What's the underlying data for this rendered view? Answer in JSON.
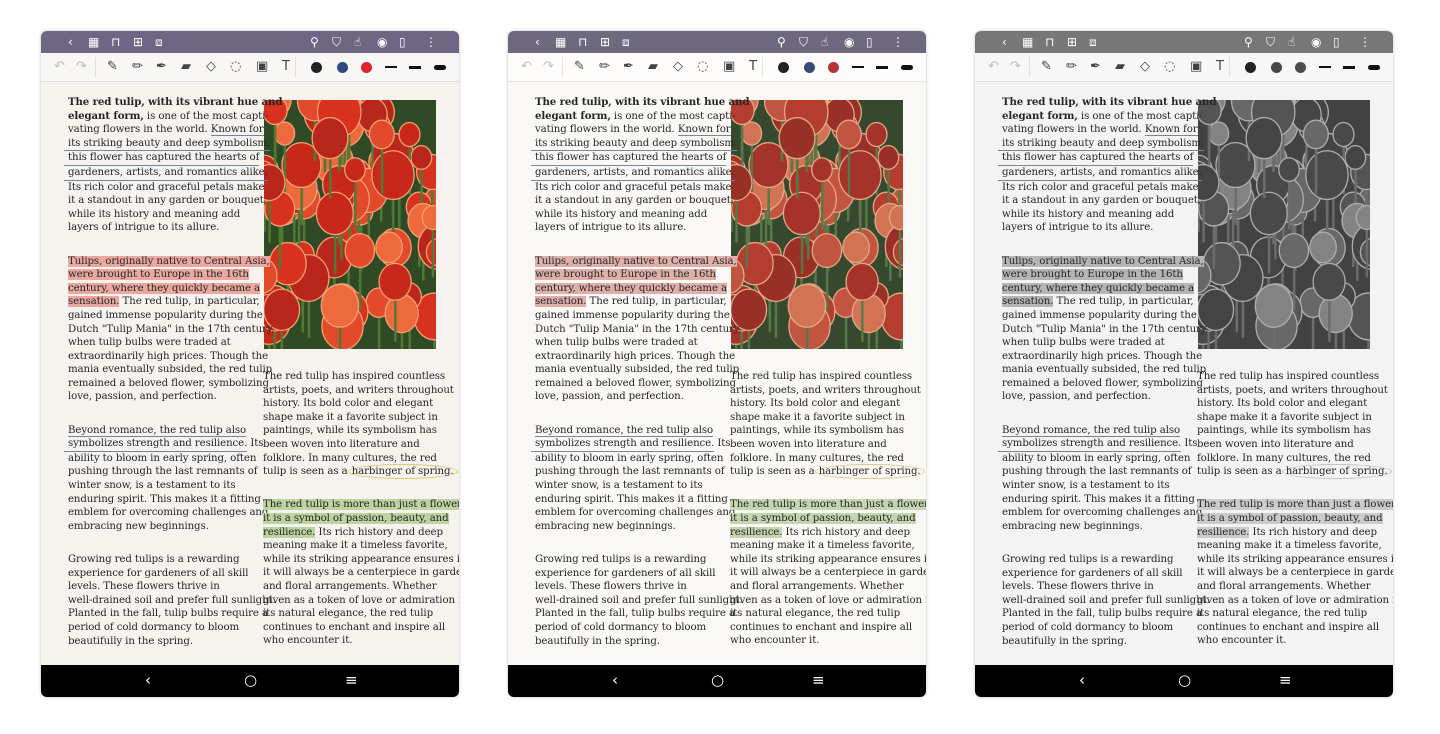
{
  "colors": {
    "topbar_color": "#6e6684",
    "topbar_gray": "#777777",
    "highlight_red": "#eaa8a0",
    "highlight_green": "#bdd3a0",
    "underline": "#6f86a3",
    "circle": "#e4c46a",
    "pen_black": "#222222",
    "pen_blue": "#2d4a86",
    "pen_red": "#e0242e"
  },
  "topbar": {
    "icons": [
      "back-icon",
      "grid-icon",
      "bookmark-icon",
      "add-page-icon",
      "crop-icon",
      "search-icon",
      "shirt-icon",
      "touch-icon",
      "eye-icon",
      "page-icon",
      "more-icon"
    ],
    "glyphs": {
      "back": "‹",
      "grid": "▦",
      "bookmark": "⊓",
      "add": "⊞",
      "crop": "⧈",
      "search": "⚲",
      "shirt": "⛉",
      "touch": "☝",
      "eye": "◉",
      "page": "▯",
      "more": "⋮"
    }
  },
  "toolbar": {
    "glyphs": {
      "undo": "↶",
      "redo": "↷",
      "pen": "✎",
      "pencil": "✏",
      "marker": "✒",
      "highlighter": "▰",
      "eraser": "◇",
      "lasso": "◌",
      "image": "▣",
      "text": "T"
    }
  },
  "navbar": {
    "glyphs": {
      "back": "‹",
      "home": "○",
      "menu": "≡"
    }
  },
  "tablets": [
    {
      "variant": "color"
    },
    {
      "variant": "e-ink color"
    },
    {
      "variant": "grayscale"
    }
  ],
  "article": {
    "col1": [
      [
        [
          [
            "The red tulip, with its vibrant hue and",
            "b"
          ]
        ],
        [
          [
            "elegant form,",
            "b"
          ],
          [
            " is one of the most capti-",
            ""
          ]
        ],
        [
          [
            "vating flowers in the world. ",
            ""
          ],
          [
            "Known for",
            "u"
          ]
        ],
        [
          [
            "its striking beauty and deep symbolism,",
            "ul"
          ]
        ],
        [
          [
            "this flower has captured the hearts of",
            "ul"
          ]
        ],
        [
          [
            "gardeners, artists, and romantics alike.",
            "ul"
          ]
        ],
        [
          [
            "Its rich color and graceful petals make",
            ""
          ]
        ],
        [
          [
            "it a standout in any garden or bouquet,",
            ""
          ]
        ],
        [
          [
            "while its history and meaning add",
            ""
          ]
        ],
        [
          [
            "layers of intrigue to its allure.",
            ""
          ]
        ]
      ],
      [
        [
          [
            "Tulips, originally native to Central Asia,",
            "hr"
          ]
        ],
        [
          [
            "were brought to Europe in the 16th",
            "hr"
          ]
        ],
        [
          [
            "century, where they quickly became a",
            "hr"
          ]
        ],
        [
          [
            "sensation.",
            "hr"
          ],
          [
            " The red tulip, in particular,",
            ""
          ]
        ],
        [
          [
            "gained immense popularity during the",
            ""
          ]
        ],
        [
          [
            "Dutch \"Tulip Mania\" in the 17th century,",
            ""
          ]
        ],
        [
          [
            "when tulip bulbs were traded at",
            ""
          ]
        ],
        [
          [
            "extraordinarily high prices. Though the",
            ""
          ]
        ],
        [
          [
            "mania eventually subsided, the red tulip",
            ""
          ]
        ],
        [
          [
            "remained a beloved flower, symbolizing",
            ""
          ]
        ],
        [
          [
            "love, passion, and perfection.",
            ""
          ]
        ]
      ],
      [
        [
          [
            "Beyond romance, the red tulip also",
            "u"
          ]
        ],
        [
          [
            "symbolizes strength and resilience.",
            "ul"
          ],
          [
            " Its",
            ""
          ]
        ],
        [
          [
            "ability to bloom in early spring, often",
            ""
          ]
        ],
        [
          [
            "pushing through the last remnants of",
            ""
          ]
        ],
        [
          [
            "winter snow, is a testament to its",
            ""
          ]
        ],
        [
          [
            "enduring spirit. This makes it a fitting",
            ""
          ]
        ],
        [
          [
            "emblem for overcoming challenges and",
            ""
          ]
        ],
        [
          [
            "embracing new beginnings.",
            ""
          ]
        ]
      ],
      [
        [
          [
            "Growing red tulips is a rewarding",
            ""
          ]
        ],
        [
          [
            "experience for gardeners of all skill",
            ""
          ]
        ],
        [
          [
            "levels. These flowers thrive in",
            ""
          ]
        ],
        [
          [
            "well-drained soil and prefer full sunlight.",
            ""
          ]
        ],
        [
          [
            "Planted in the fall, tulip bulbs require a",
            ""
          ]
        ],
        [
          [
            "period of cold dormancy to bloom",
            ""
          ]
        ],
        [
          [
            "beautifully in the spring.",
            ""
          ]
        ]
      ]
    ],
    "col2": [
      [
        [
          [
            "The red tulip has inspired countless",
            ""
          ]
        ],
        [
          [
            "artists, poets, and writers throughout",
            ""
          ]
        ],
        [
          [
            "history. Its bold color and elegant",
            ""
          ]
        ],
        [
          [
            "shape make it a favorite subject in",
            ""
          ]
        ],
        [
          [
            "paintings, while its symbolism has",
            ""
          ]
        ],
        [
          [
            "been woven into literature and",
            ""
          ]
        ],
        [
          [
            "folklore. In many cultures, the red",
            ""
          ]
        ],
        [
          [
            "tulip is seen as a ",
            ""
          ],
          [
            "harbinger of spring.",
            "c"
          ]
        ]
      ],
      [
        [
          [
            "The red tulip is more than just a flower;",
            "hg"
          ]
        ],
        [
          [
            "it is a symbol of passion, beauty, and",
            "hg"
          ]
        ],
        [
          [
            "resilience.",
            "hg"
          ],
          [
            " Its rich history and deep",
            ""
          ]
        ],
        [
          [
            "meaning make it a timeless favorite,",
            ""
          ]
        ],
        [
          [
            "while its striking appearance ensures it",
            ""
          ]
        ],
        [
          [
            "it will always be a centerpiece in gardens",
            ""
          ]
        ],
        [
          [
            "and floral arrangements. Whether",
            ""
          ]
        ],
        [
          [
            "given as a token of love or admiration for",
            ""
          ]
        ],
        [
          [
            "its natural elegance, the red tulip",
            ""
          ]
        ],
        [
          [
            "continues to enchant and inspire all",
            ""
          ]
        ],
        [
          [
            "who encounter it.",
            ""
          ]
        ]
      ]
    ]
  }
}
